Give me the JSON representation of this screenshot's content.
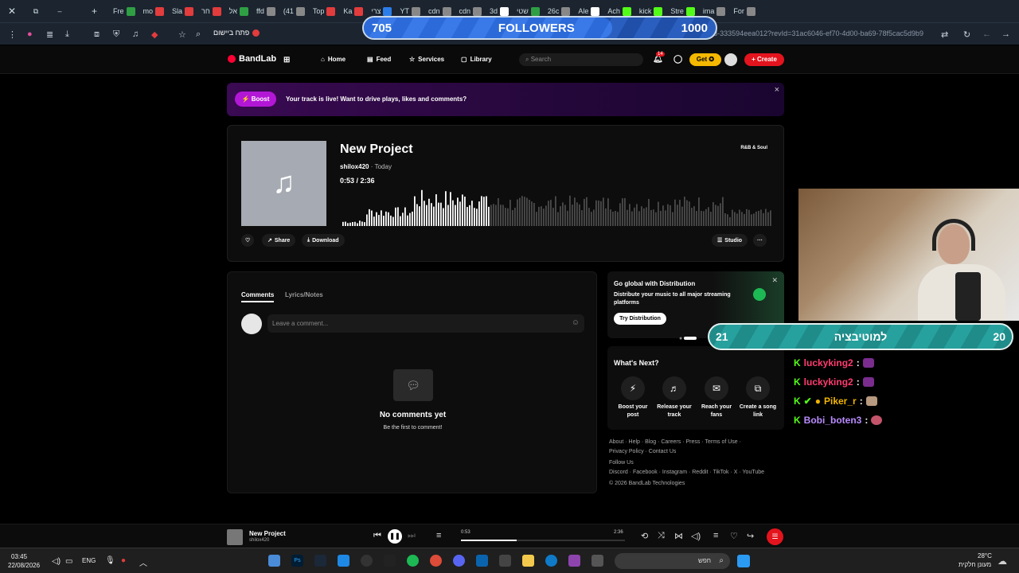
{
  "browser": {
    "tabs": [
      "Fre",
      "mo",
      "Sla",
      "חר",
      "אל",
      "ffd",
      "(41",
      "Top",
      "Ka",
      "צרי",
      "YT",
      "cdn",
      "cdn",
      "3d",
      "שטי",
      "26c",
      "Ale",
      "Ach",
      "kick",
      "Stre",
      "ima",
      "For"
    ],
    "url": "om/track/d445a80f-4fa1-4ea3-9a68-333594eea012?revId=31ac6046-ef70-4d00-ba69-78f5cac5d9b9",
    "open_in_app": "פתח ביישום"
  },
  "stream_overlay": {
    "followers_current": "705",
    "followers_label": "FOLLOWERS",
    "followers_goal": "1000",
    "followers_progress": 0.705,
    "motivation_left": "21",
    "motivation_label": "למוטיבציה",
    "motivation_right": "20",
    "chat": [
      {
        "user": "luckyking2",
        "sep": ":"
      },
      {
        "user": "luckyking2",
        "sep": ":"
      },
      {
        "user": "Piker_r",
        "sep": ":"
      },
      {
        "user": "Bobi_boten3",
        "sep": ":"
      }
    ]
  },
  "nav": {
    "logo": "BandLab",
    "home": "Home",
    "feed": "Feed",
    "services": "Services",
    "library": "Library",
    "search_placeholder": "Search",
    "notif_count": "14",
    "get": "Get",
    "create": "Create"
  },
  "boost": {
    "button": "Boost",
    "message": "Your track is live! Want to drive plays, likes and comments?",
    "close": "×"
  },
  "track": {
    "title": "New Project",
    "artist": "shilox420",
    "date": "Today",
    "time": "0:53 / 2:36",
    "genre": "R&B & Soul",
    "played_fraction": 0.34,
    "share": "Share",
    "download": "Download",
    "studio": "Studio",
    "more": "···"
  },
  "comments": {
    "tab_comments": "Comments",
    "tab_lyrics": "Lyrics/Notes",
    "placeholder": "Leave a comment...",
    "empty_title": "No comments yet",
    "empty_sub": "Be the first to comment!"
  },
  "distribution": {
    "heading": "Go global with Distribution",
    "description": "Distribute your music to all major streaming platforms",
    "button": "Try Distribution"
  },
  "whats_next": {
    "heading": "What's Next?",
    "items": [
      "Boost your post",
      "Release your track",
      "Reach your fans",
      "Create a song link"
    ]
  },
  "footer": {
    "links1": "About · Help · Blog · Careers · Press · Terms of Use ·",
    "links2": "Privacy Policy · Contact Us",
    "follow": "Follow Us",
    "social": "Discord · Facebook · Instagram · Reddit · TikTok · X · YouTube",
    "copyright": "© 2026 BandLab Technologies"
  },
  "player": {
    "title": "New Project",
    "artist": "shilox420",
    "current": "0:53",
    "duration": "2:36",
    "progress": 0.34
  },
  "taskbar": {
    "time": "03:45",
    "date": "22/08/2026",
    "lang": "ENG",
    "search": "חפש",
    "weather_temp": "28°C",
    "weather_desc": "מעונן חלקית"
  }
}
